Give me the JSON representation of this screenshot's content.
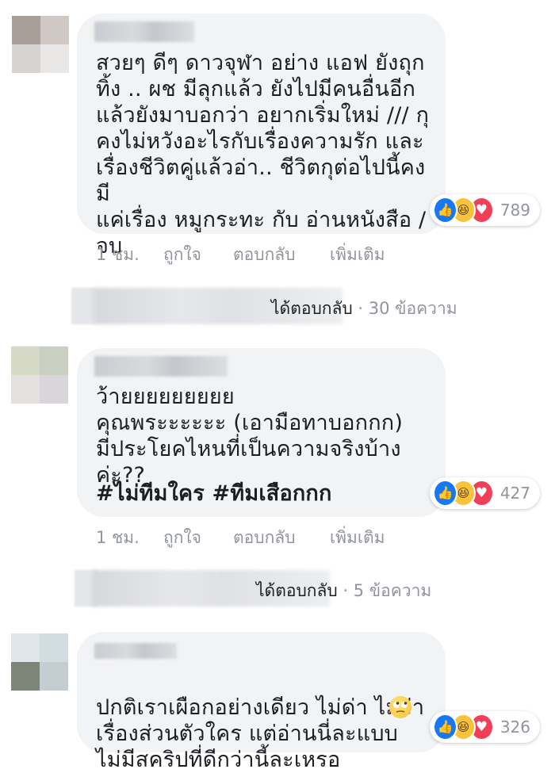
{
  "comments": [
    {
      "text": "สวยๆ ดีๆ ดาวจุฬา อย่าง แอฟ ยังถุก\nทิ้ง .. ผช มีลุกแล้ว ยังไปมีคนอื่นอีก\nแล้วยังมาบอกว่า อยากเริ่มใหม่ /// กุ\nคงไม่หวังอะไรกับเรื่องความรัก และ\nเรื่องชีวิตคู่แล้วอ่า.. ชีวิตกุต่อไปนี้คงมี\nแค่เรื่อง หมูกระทะ กับ อ่านหนังสือ /\nจบ",
      "reaction_count": "789",
      "time": "1 ชม.",
      "like_label": "ถูกใจ",
      "reply_label": "ตอบกลับ",
      "more_label": "เพิ่มเติม",
      "replies": {
        "label": "ได้ตอบกลับ",
        "count": "· 30 ข้อความ"
      }
    },
    {
      "text": "ว้ายยยยยยยยย\nคุณพระะะะะะ (เอามือทาบอกกก)\nมีประโยคไหนที่เป็นความจริงบ้าง\nค่ะ??",
      "hashtags": "#ไม่ทีมใคร #ทีมเสือกกก",
      "reaction_count": "427",
      "time": "1 ชม.",
      "like_label": "ถูกใจ",
      "reply_label": "ตอบกลับ",
      "more_label": "เพิ่มเติม",
      "replies": {
        "label": "ได้ตอบกลับ",
        "count": "· 5 ข้อความ"
      }
    },
    {
      "text": "ปกติเราเผือกอย่างเดียว ไม่ด่า ไม่ว่า\nเรื่องส่วนตัวใคร แต่อ่านนี่ละแบบ\nไม่มีสคริปที่ดีกว่านี้ละเหรอ",
      "reaction_count": "326"
    }
  ],
  "colors": {
    "bubble": "#f2f3f5",
    "muted": "#90949c",
    "like": "#1877f2",
    "haha": "#f7c33b",
    "love": "#f33e58"
  },
  "icons": [
    "like-reaction-icon",
    "haha-reaction-icon",
    "love-reaction-icon",
    "rolling-eyes-emoji"
  ]
}
